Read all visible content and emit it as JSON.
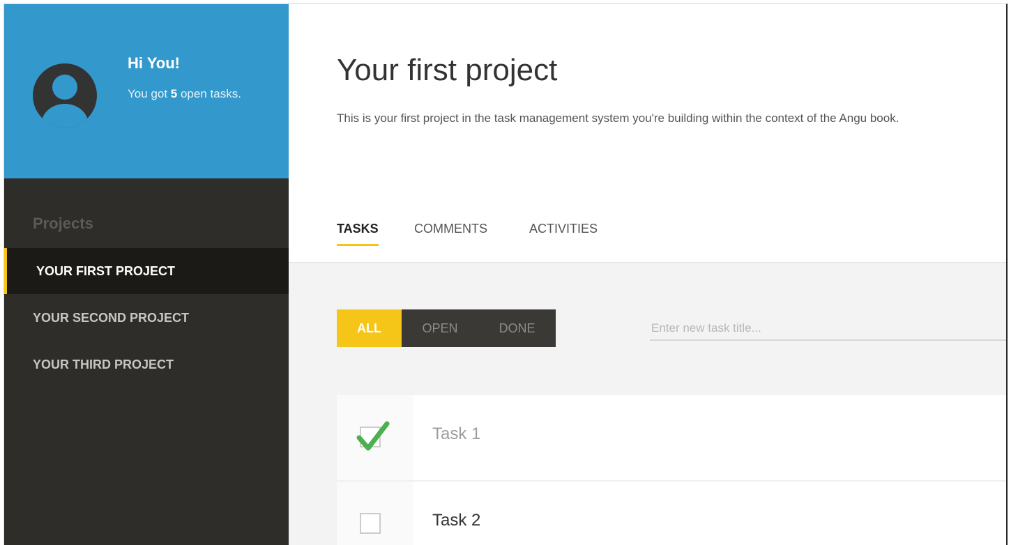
{
  "user": {
    "greeting": "Hi You!",
    "open_tasks_prefix": "You got ",
    "open_tasks_count": "5",
    "open_tasks_suffix": " open tasks."
  },
  "sidebar": {
    "heading": "Projects",
    "projects": [
      {
        "label": "YOUR FIRST PROJECT",
        "active": true
      },
      {
        "label": "YOUR SECOND PROJECT",
        "active": false
      },
      {
        "label": "YOUR THIRD PROJECT",
        "active": false
      }
    ]
  },
  "project": {
    "title": "Your first project",
    "description": "This is your first project in the task management system you're building within the context of the Angu book."
  },
  "tabs": [
    {
      "label": "TASKS",
      "active": true
    },
    {
      "label": "COMMENTS",
      "active": false
    },
    {
      "label": "ACTIVITIES",
      "active": false
    }
  ],
  "filters": [
    {
      "label": "ALL",
      "active": true
    },
    {
      "label": "OPEN",
      "active": false
    },
    {
      "label": "DONE",
      "active": false
    }
  ],
  "new_task": {
    "placeholder": "Enter new task title...",
    "value": ""
  },
  "tasks": [
    {
      "title": "Task 1",
      "done": true
    },
    {
      "title": "Task 2",
      "done": false
    }
  ],
  "colors": {
    "accent_blue": "#3399cc",
    "sidebar_bg": "#2e2d29",
    "highlight_yellow": "#f5c518",
    "check_green": "#4caf50"
  },
  "icons": {
    "avatar": "user-avatar-icon",
    "done_check": "check-mark-icon"
  }
}
